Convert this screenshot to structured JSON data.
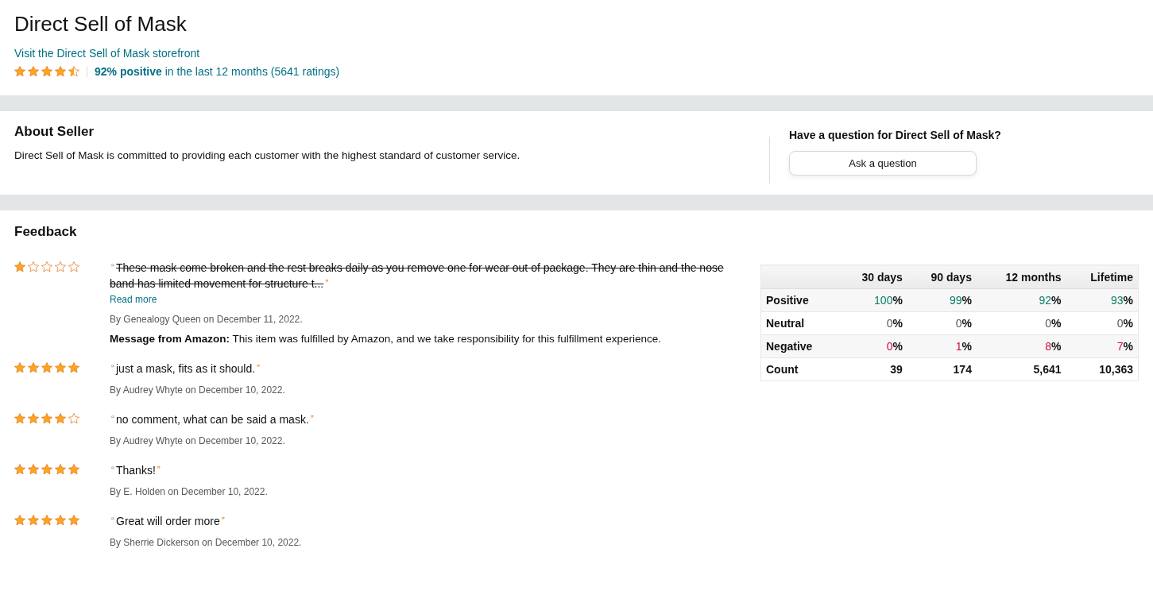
{
  "header": {
    "title": "Direct Sell of Mask",
    "storefront_link": "Visit the Direct Sell of Mask storefront",
    "stars": 4.5,
    "rating_bold": "92% positive",
    "rating_rest": "in the last 12 months (5641 ratings)"
  },
  "about": {
    "heading": "About Seller",
    "text": "Direct Sell of Mask is committed to providing each customer with the highest standard of customer service.",
    "question": "Have a question for Direct Sell of Mask?",
    "ask_button": "Ask a question"
  },
  "feedback": {
    "heading": "Feedback",
    "reviews": [
      {
        "stars": 1,
        "quote_open": "“",
        "text": "These mask come broken and the rest breaks daily as you remove one for wear out of package. They are thin and the nose band has limited movement for structure t...",
        "quote_close": "”",
        "struck": true,
        "read_more": "Read more",
        "byline": "By Genealogy Queen on December 11, 2022.",
        "message_label": "Message from Amazon:",
        "message": "This item was fulfilled by Amazon, and we take responsibility for this fulfillment experience."
      },
      {
        "stars": 5,
        "quote_open": "“",
        "text": "just a mask, fits as it should.",
        "quote_close": "”",
        "struck": false,
        "byline": "By Audrey Whyte on December 10, 2022."
      },
      {
        "stars": 4,
        "quote_open": "“",
        "text": "no comment, what can be said a mask.",
        "quote_close": "”",
        "struck": false,
        "byline": "By Audrey Whyte on December 10, 2022."
      },
      {
        "stars": 5,
        "quote_open": "“",
        "text": "Thanks!",
        "quote_close": "”",
        "struck": false,
        "byline": "By E. Holden on December 10, 2022."
      },
      {
        "stars": 5,
        "quote_open": "“",
        "text": "Great will order more",
        "quote_close": "”",
        "struck": false,
        "byline": "By Sherrie Dickerson on December 10, 2022."
      }
    ],
    "table": {
      "columns": [
        "30 days",
        "90 days",
        "12 months",
        "Lifetime"
      ],
      "rows": [
        {
          "kind": "positive",
          "label": "Positive",
          "cells": [
            {
              "number": "100",
              "suffix": "%"
            },
            {
              "number": "99",
              "suffix": "%"
            },
            {
              "number": "92",
              "suffix": "%"
            },
            {
              "number": "93",
              "suffix": "%"
            }
          ]
        },
        {
          "kind": "neutral",
          "label": "Neutral",
          "cells": [
            {
              "number": "0",
              "suffix": "%"
            },
            {
              "number": "0",
              "suffix": "%"
            },
            {
              "number": "0",
              "suffix": "%"
            },
            {
              "number": "0",
              "suffix": "%"
            }
          ]
        },
        {
          "kind": "negative",
          "label": "Negative",
          "cells": [
            {
              "number": "0",
              "suffix": "%"
            },
            {
              "number": "1",
              "suffix": "%"
            },
            {
              "number": "8",
              "suffix": "%"
            },
            {
              "number": "7",
              "suffix": "%"
            }
          ]
        },
        {
          "kind": "count",
          "label": "Count",
          "cells": [
            {
              "number": "39"
            },
            {
              "number": "174"
            },
            {
              "number": "5,641"
            },
            {
              "number": "10,363"
            }
          ]
        }
      ]
    }
  }
}
